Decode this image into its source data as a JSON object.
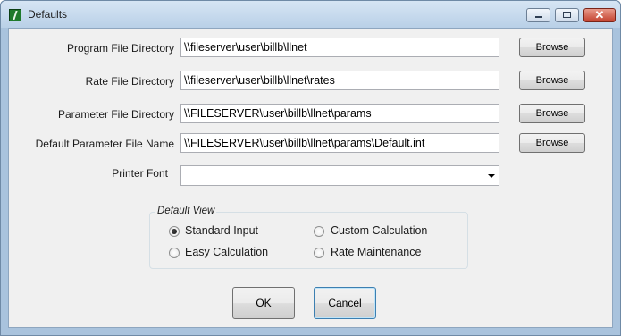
{
  "window": {
    "title": "Defaults"
  },
  "fields": [
    {
      "label": "Program File Directory",
      "value": "\\\\fileserver\\user\\billb\\llnet",
      "button": "Browse"
    },
    {
      "label": "Rate File Directory",
      "value": "\\\\fileserver\\user\\billb\\llnet\\rates",
      "button": "Browse"
    },
    {
      "label": "Parameter File Directory",
      "value": "\\\\FILESERVER\\user\\billb\\llnet\\params",
      "button": "Browse"
    },
    {
      "label": "Default Parameter File Name",
      "value": "\\\\FILESERVER\\user\\billb\\llnet\\params\\Default.int",
      "button": "Browse"
    }
  ],
  "printer_font": {
    "label": "Printer Font",
    "value": ""
  },
  "default_view": {
    "title": "Default View",
    "selected": "Standard Input",
    "options": [
      "Standard Input",
      "Custom Calculation",
      "Easy Calculation",
      "Rate Maintenance"
    ]
  },
  "buttons": {
    "ok": "OK",
    "cancel": "Cancel"
  }
}
